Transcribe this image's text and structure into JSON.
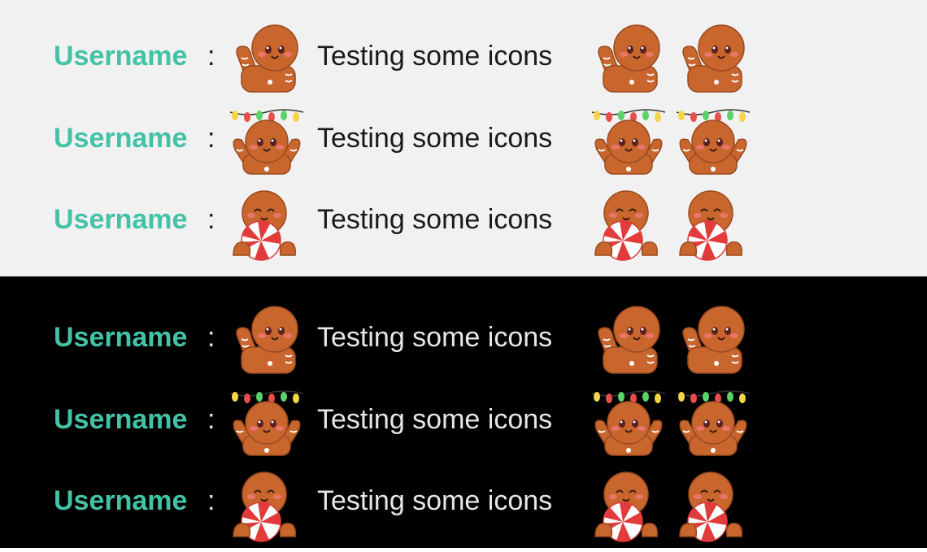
{
  "accent_color": "#43c3a6",
  "panels": [
    {
      "theme": "light",
      "background": "#f1f1f1",
      "rows": [
        {
          "username": "Username",
          "separator": ":",
          "message": "Testing some icons",
          "emote_icon": "gingerbread-wave-icon"
        },
        {
          "username": "Username",
          "separator": ":",
          "message": "Testing some icons",
          "emote_icon": "gingerbread-lights-icon"
        },
        {
          "username": "Username",
          "separator": ":",
          "message": "Testing some icons",
          "emote_icon": "gingerbread-candy-icon"
        }
      ]
    },
    {
      "theme": "dark",
      "background": "#000000",
      "rows": [
        {
          "username": "Username",
          "separator": ":",
          "message": "Testing some icons",
          "emote_icon": "gingerbread-wave-icon"
        },
        {
          "username": "Username",
          "separator": ":",
          "message": "Testing some icons",
          "emote_icon": "gingerbread-lights-icon"
        },
        {
          "username": "Username",
          "separator": ":",
          "message": "Testing some icons",
          "emote_icon": "gingerbread-candy-icon"
        }
      ]
    }
  ]
}
